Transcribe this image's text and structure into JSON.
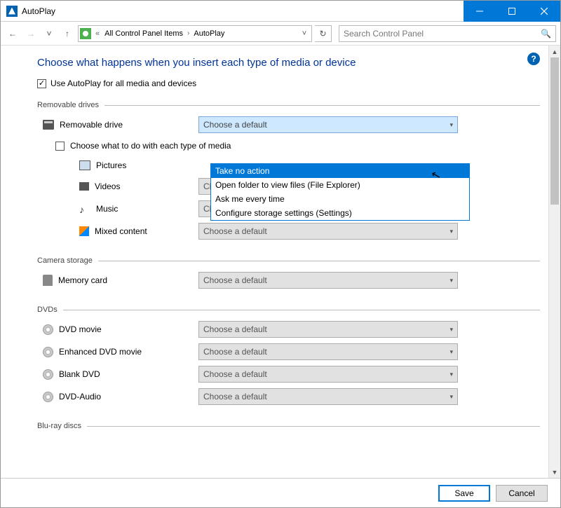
{
  "window": {
    "title": "AutoPlay"
  },
  "nav": {
    "crumb_root": "All Control Panel Items",
    "crumb_leaf": "AutoPlay",
    "search_placeholder": "Search Control Panel"
  },
  "page": {
    "heading": "Choose what happens when you insert each type of media or device",
    "use_autoplay_label": "Use AutoPlay for all media and devices"
  },
  "sections": {
    "removable": {
      "title": "Removable drives",
      "drive_label": "Removable drive",
      "choose_each_label": "Choose what to do with each type of media",
      "pictures": "Pictures",
      "videos": "Videos",
      "music": "Music",
      "mixed": "Mixed content"
    },
    "camera": {
      "title": "Camera storage",
      "memory_card": "Memory card"
    },
    "dvds": {
      "title": "DVDs",
      "dvd_movie": "DVD movie",
      "enhanced": "Enhanced DVD movie",
      "blank": "Blank DVD",
      "audio": "DVD-Audio"
    },
    "bluray": {
      "title": "Blu-ray discs"
    }
  },
  "combo": {
    "placeholder": "Choose a default"
  },
  "dropdown": {
    "opt0": "Take no action",
    "opt1": "Open folder to view files (File Explorer)",
    "opt2": "Ask me every time",
    "opt3": "Configure storage settings (Settings)"
  },
  "footer": {
    "save": "Save",
    "cancel": "Cancel"
  }
}
